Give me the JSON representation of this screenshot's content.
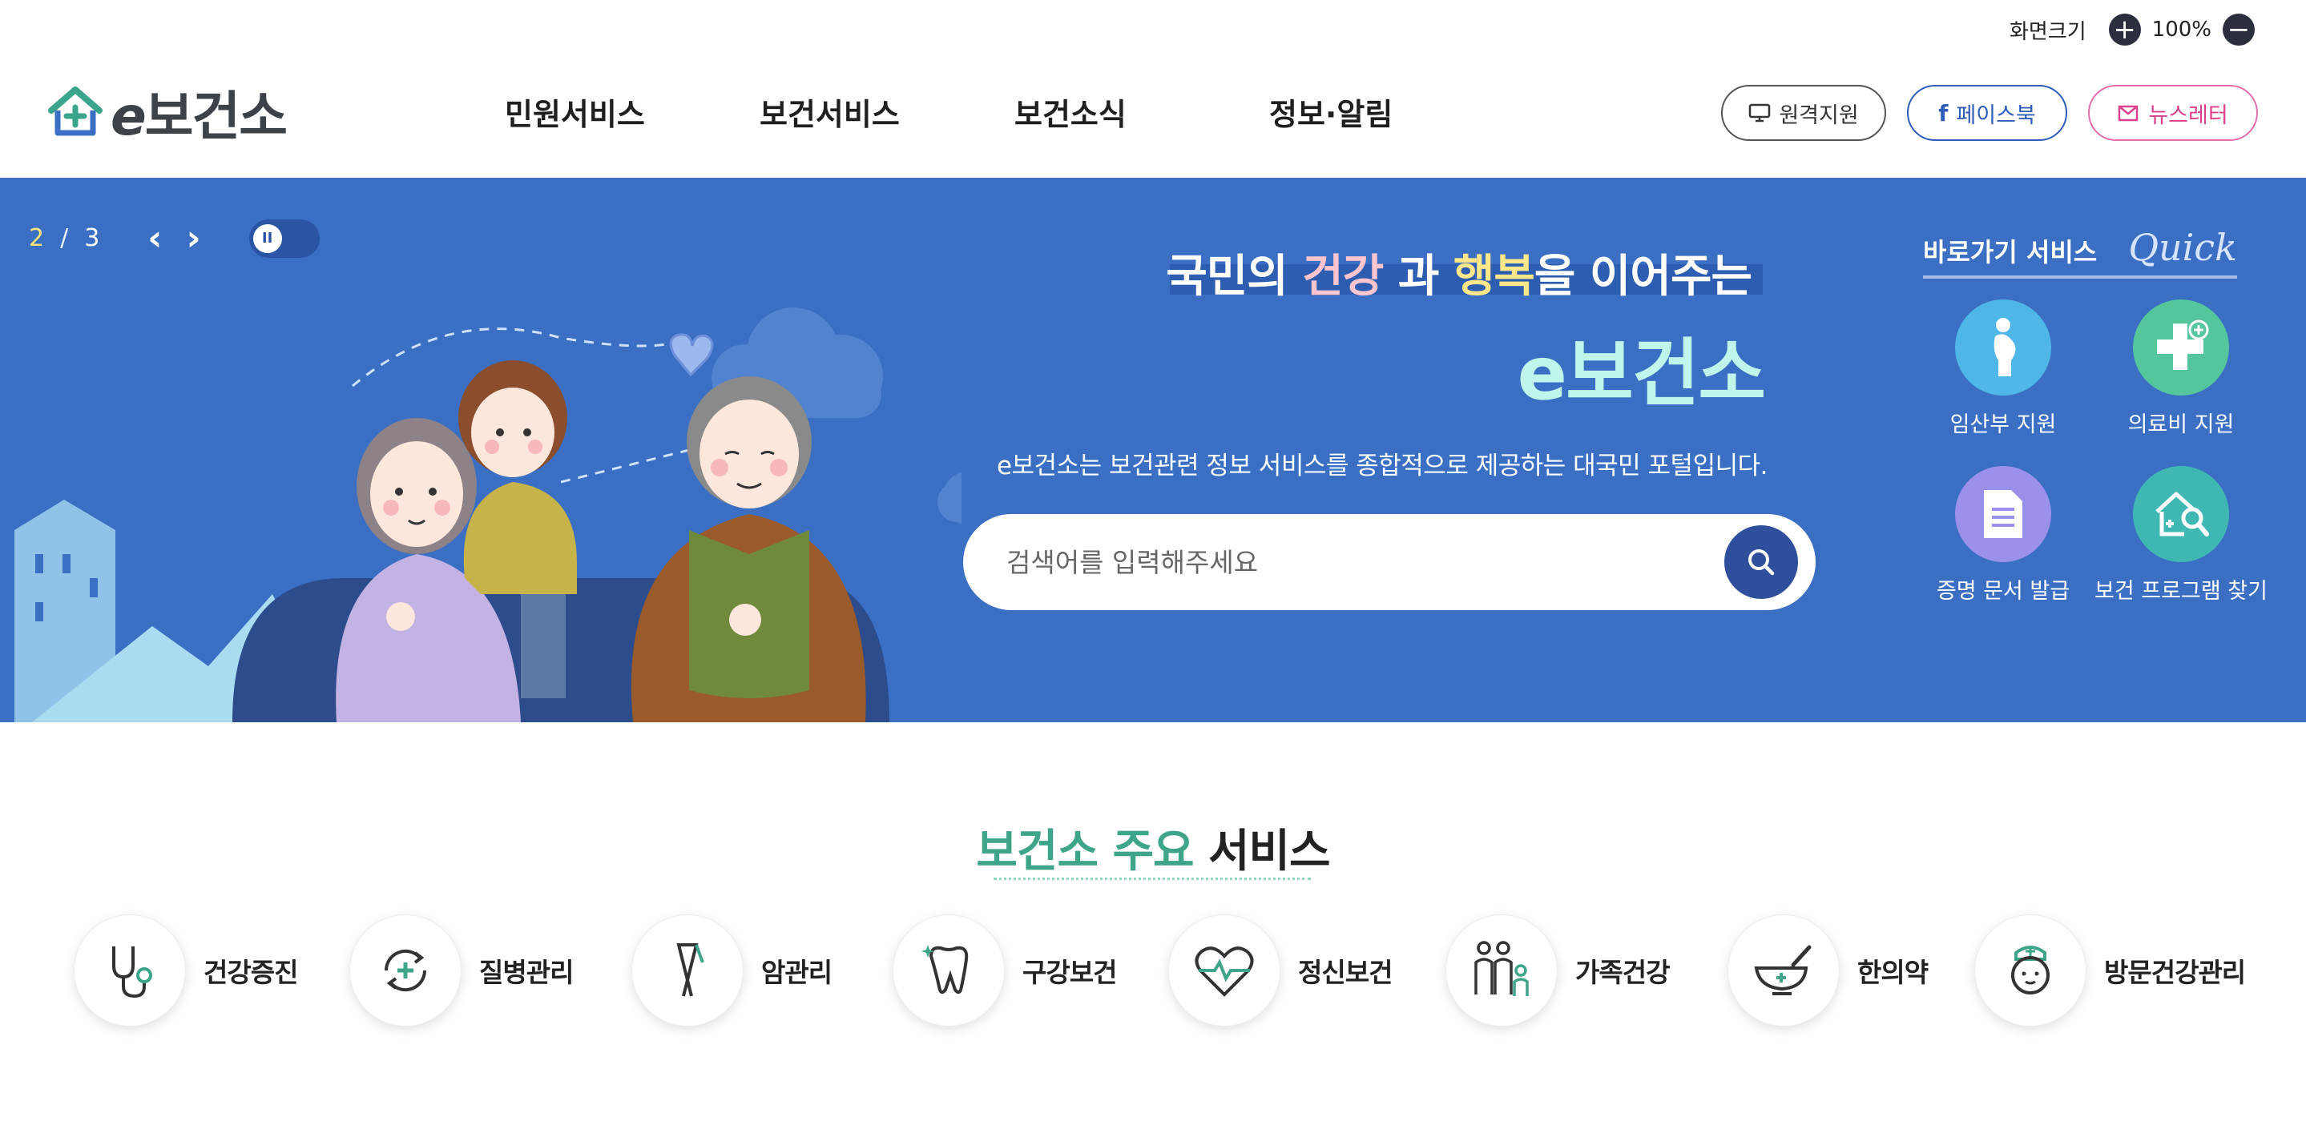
{
  "zoom": {
    "label": "화면크기",
    "value": "100%",
    "plus": "+",
    "minus": "−"
  },
  "header": {
    "logo": {
      "e": "e",
      "name": "보건소"
    },
    "nav": [
      "민원서비스",
      "보건서비스",
      "보건소식",
      "정보·알림"
    ],
    "buttons": {
      "remote": "원격지원",
      "facebook": "페이스북",
      "newsletter": "뉴스레터"
    }
  },
  "hero": {
    "slide": {
      "current": "2",
      "sep": "/",
      "total": "3",
      "prev": "‹",
      "next": "›"
    },
    "headline": {
      "pre": "국민의 ",
      "k1": "건강",
      "mid": " 과 ",
      "k2": "행복",
      "post": "을 이어주는"
    },
    "brand": "e보건소",
    "description": "e보건소는 보건관련 정보 서비스를 종합적으로 제공하는 대국민 포털입니다.",
    "search_placeholder": "검색어를 입력해주세요"
  },
  "quick": {
    "title": "바로가기 서비스",
    "script": "Quick",
    "items": [
      {
        "label": "임산부 지원",
        "icon": "pregnant-woman-icon",
        "color": "#4fb6e8"
      },
      {
        "label": "의료비 지원",
        "icon": "medical-plus-icon",
        "color": "#55c59c"
      },
      {
        "label": "증명 문서 발급",
        "icon": "document-icon",
        "color": "#9b91ea"
      },
      {
        "label": "보건 프로그램 찾기",
        "icon": "house-search-icon",
        "color": "#3fb7b3"
      }
    ]
  },
  "services": {
    "title_green": "보건소 주요",
    "title_dark": "서비스",
    "items": [
      {
        "label": "건강증진",
        "icon": "stethoscope-icon"
      },
      {
        "label": "질병관리",
        "icon": "cycle-plus-icon"
      },
      {
        "label": "암관리",
        "icon": "ribbon-icon"
      },
      {
        "label": "구강보건",
        "icon": "tooth-icon"
      },
      {
        "label": "정신보건",
        "icon": "heart-pulse-icon"
      },
      {
        "label": "가족건강",
        "icon": "family-icon"
      },
      {
        "label": "한의약",
        "icon": "mortar-icon"
      },
      {
        "label": "방문건강관리",
        "icon": "nurse-icon"
      }
    ]
  },
  "colors": {
    "hero_bg": "#3a6fc4",
    "accent_green": "#3ea48a",
    "search_btn": "#2f4f9d"
  }
}
